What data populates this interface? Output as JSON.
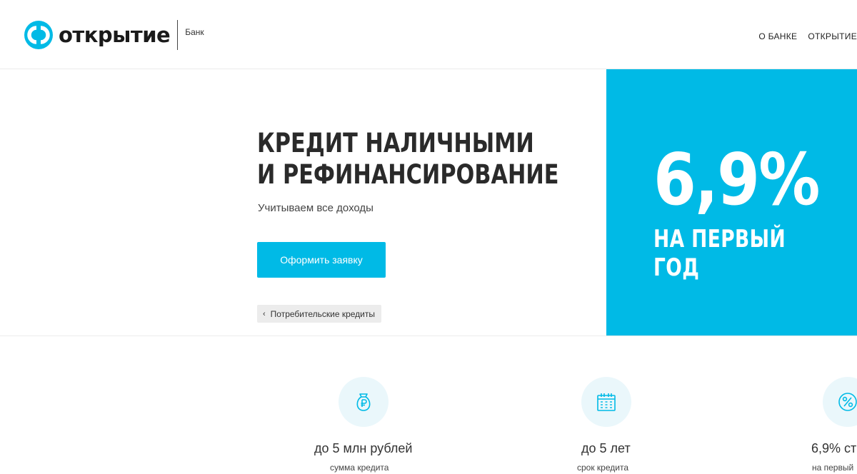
{
  "header": {
    "logo_text": "открытие",
    "logo_subtext": "Банк",
    "nav": [
      "О БАНКЕ",
      "ОТКРЫТИЕ"
    ]
  },
  "hero": {
    "title_line1": "КРЕДИТ НАЛИЧНЫМИ",
    "title_line2": "И РЕФИНАНСИРОВАНИЕ",
    "subtitle": "Учитываем все доходы",
    "cta_label": "Оформить заявку",
    "breadcrumb": "Потребительские кредиты"
  },
  "promo": {
    "rate": "6,9%",
    "caption": "НА ПЕРВЫЙ ГОД",
    "color": "#00bae6"
  },
  "features": [
    {
      "icon": "money-bag-icon",
      "title": "до 5 млн рублей",
      "subtitle": "сумма кредита"
    },
    {
      "icon": "calendar-icon",
      "title": "до 5 лет",
      "subtitle": "срок кредита"
    },
    {
      "icon": "percent-icon",
      "title": "6,9% ст",
      "subtitle": "на первый"
    }
  ],
  "colors": {
    "accent": "#00bae6",
    "icon_circle_bg": "#eaf7fb"
  }
}
